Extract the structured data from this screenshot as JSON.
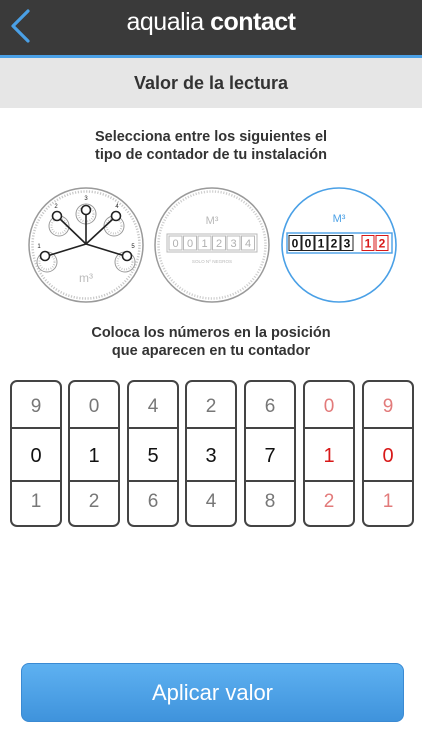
{
  "header": {
    "back_icon": "chevron-left-icon",
    "logo_part1": "aqualia",
    "logo_part2": "contact",
    "accent_color": "#4aa0e6"
  },
  "subheader": {
    "title": "Valor de la lectura"
  },
  "instructions": {
    "select_line1": "Selecciona entre los siguientes el",
    "select_line2": "tipo de contador de tu instalación",
    "position_line1": "Coloca los números en la posición",
    "position_line2": "que aparecen en tu contador"
  },
  "meters": [
    {
      "name": "dial-meter",
      "unit": "m³",
      "dial_labels": [
        "1",
        "2",
        "3",
        "4",
        "5"
      ],
      "selected": false
    },
    {
      "name": "black-digits-meter",
      "unit": "M³",
      "digits": [
        "0",
        "0",
        "1",
        "2",
        "3",
        "4"
      ],
      "caption": "SOLO Nº NEGROS",
      "selected": false
    },
    {
      "name": "black-red-digits-meter",
      "unit": "M³",
      "black_digits": [
        "0",
        "0",
        "1",
        "2",
        "3"
      ],
      "red_digits": [
        "1",
        "2"
      ],
      "selected": true
    }
  ],
  "wheels": [
    {
      "prev": "9",
      "current": "0",
      "next": "1",
      "color": "black"
    },
    {
      "prev": "0",
      "current": "1",
      "next": "2",
      "color": "black"
    },
    {
      "prev": "4",
      "current": "5",
      "next": "6",
      "color": "black"
    },
    {
      "prev": "2",
      "current": "3",
      "next": "4",
      "color": "black"
    },
    {
      "prev": "6",
      "current": "7",
      "next": "8",
      "color": "black"
    },
    {
      "prev": "0",
      "current": "1",
      "next": "2",
      "color": "red"
    },
    {
      "prev": "9",
      "current": "0",
      "next": "1",
      "color": "red"
    }
  ],
  "apply_button": {
    "label": "Aplicar valor",
    "color": "#4a9fe6"
  }
}
